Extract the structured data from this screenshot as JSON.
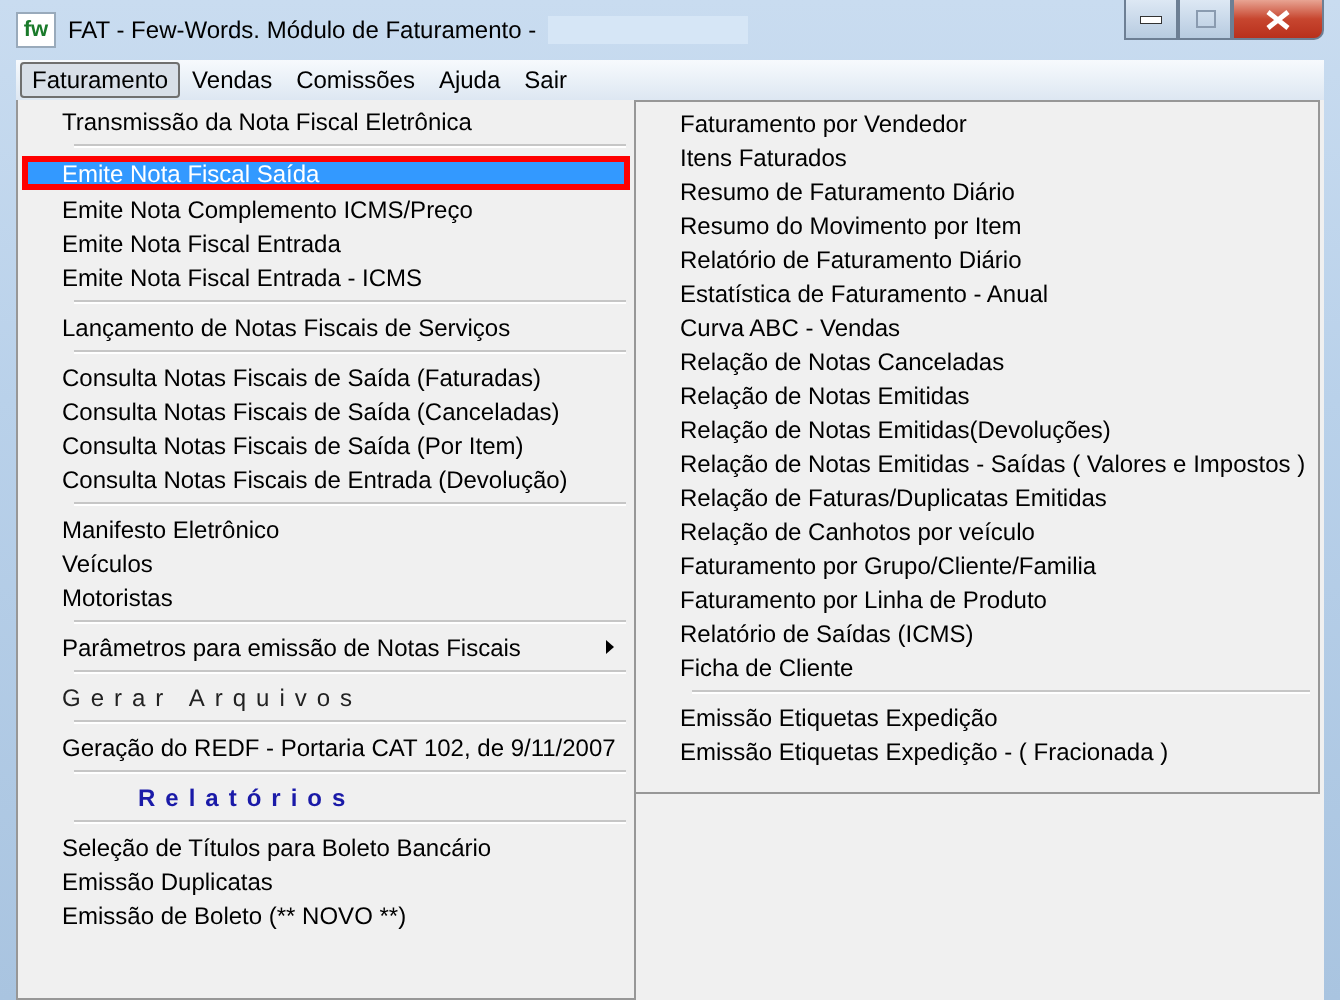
{
  "window": {
    "icon_text": "fw",
    "title": "FAT - Few-Words. Módulo de Faturamento -"
  },
  "menubar": [
    {
      "label": "Faturamento",
      "selected": true
    },
    {
      "label": "Vendas",
      "selected": false
    },
    {
      "label": "Comissões",
      "selected": false
    },
    {
      "label": "Ajuda",
      "selected": false
    },
    {
      "label": "Sair",
      "selected": false
    }
  ],
  "menu_left": [
    {
      "kind": "item",
      "label": "Transmissão da Nota Fiscal Eletrônica",
      "selected": false
    },
    {
      "kind": "separator"
    },
    {
      "kind": "item",
      "label": "Emite Nota Fiscal Saída",
      "selected": true
    },
    {
      "kind": "item",
      "label": "Emite Nota Complemento ICMS/Preço",
      "selected": false
    },
    {
      "kind": "item",
      "label": "Emite Nota Fiscal Entrada",
      "selected": false
    },
    {
      "kind": "item",
      "label": "Emite Nota Fiscal Entrada - ICMS",
      "selected": false
    },
    {
      "kind": "separator"
    },
    {
      "kind": "item",
      "label": "Lançamento de Notas Fiscais de Serviços",
      "selected": false
    },
    {
      "kind": "separator"
    },
    {
      "kind": "item",
      "label": "Consulta Notas Fiscais de Saída (Faturadas)",
      "selected": false
    },
    {
      "kind": "item",
      "label": "Consulta Notas Fiscais de Saída (Canceladas)",
      "selected": false
    },
    {
      "kind": "item",
      "label": "Consulta Notas Fiscais de Saída (Por Item)",
      "selected": false
    },
    {
      "kind": "item",
      "label": "Consulta Notas Fiscais de Entrada (Devolução)",
      "selected": false
    },
    {
      "kind": "separator"
    },
    {
      "kind": "item",
      "label": "Manifesto Eletrônico",
      "selected": false
    },
    {
      "kind": "item",
      "label": "Veículos",
      "selected": false
    },
    {
      "kind": "item",
      "label": "Motoristas",
      "selected": false
    },
    {
      "kind": "separator"
    },
    {
      "kind": "submenu",
      "label": "Parâmetros para emissão de Notas Fiscais",
      "selected": false
    },
    {
      "kind": "separator"
    },
    {
      "kind": "heading",
      "label": "Gerar Arquivos"
    },
    {
      "kind": "separator"
    },
    {
      "kind": "item",
      "label": "Geração do REDF - Portaria CAT 102, de 9/11/2007",
      "selected": false
    },
    {
      "kind": "separator"
    },
    {
      "kind": "section",
      "label": "Relatórios"
    },
    {
      "kind": "separator"
    },
    {
      "kind": "item",
      "label": "Seleção de Títulos para Boleto Bancário",
      "selected": false
    },
    {
      "kind": "item",
      "label": "Emissão Duplicatas",
      "selected": false
    },
    {
      "kind": "item",
      "label": "Emissão de Boleto (** NOVO **)",
      "selected": false
    }
  ],
  "menu_right": [
    {
      "kind": "item",
      "label": "Faturamento por Vendedor",
      "selected": false
    },
    {
      "kind": "item",
      "label": "Itens Faturados",
      "selected": false
    },
    {
      "kind": "item",
      "label": "Resumo de Faturamento Diário",
      "selected": false
    },
    {
      "kind": "item",
      "label": "Resumo do Movimento por Item",
      "selected": false
    },
    {
      "kind": "item",
      "label": "Relatório de Faturamento Diário",
      "selected": false
    },
    {
      "kind": "item",
      "label": "Estatística de Faturamento - Anual",
      "selected": false
    },
    {
      "kind": "item",
      "label": "Curva ABC - Vendas",
      "selected": false
    },
    {
      "kind": "item",
      "label": "Relação de Notas Canceladas",
      "selected": false
    },
    {
      "kind": "item",
      "label": "Relação de Notas Emitidas",
      "selected": false
    },
    {
      "kind": "item",
      "label": "Relação de Notas Emitidas(Devoluções)",
      "selected": false
    },
    {
      "kind": "item",
      "label": "Relação de Notas Emitidas - Saídas ( Valores e Impostos )",
      "selected": false
    },
    {
      "kind": "item",
      "label": "Relação de Faturas/Duplicatas Emitidas",
      "selected": false
    },
    {
      "kind": "item",
      "label": "Relação de Canhotos por veículo",
      "selected": false
    },
    {
      "kind": "item",
      "label": "Faturamento por Grupo/Cliente/Familia",
      "selected": false
    },
    {
      "kind": "item",
      "label": "Faturamento por Linha de Produto",
      "selected": false
    },
    {
      "kind": "item",
      "label": "Relatório de  Saídas (ICMS)",
      "selected": false
    },
    {
      "kind": "item",
      "label": "Ficha de Cliente",
      "selected": false
    },
    {
      "kind": "separator"
    },
    {
      "kind": "item",
      "label": "Emissão Etiquetas Expedição",
      "selected": false
    },
    {
      "kind": "item",
      "label": "Emissão Etiquetas Expedição - ( Fracionada )",
      "selected": false
    }
  ]
}
